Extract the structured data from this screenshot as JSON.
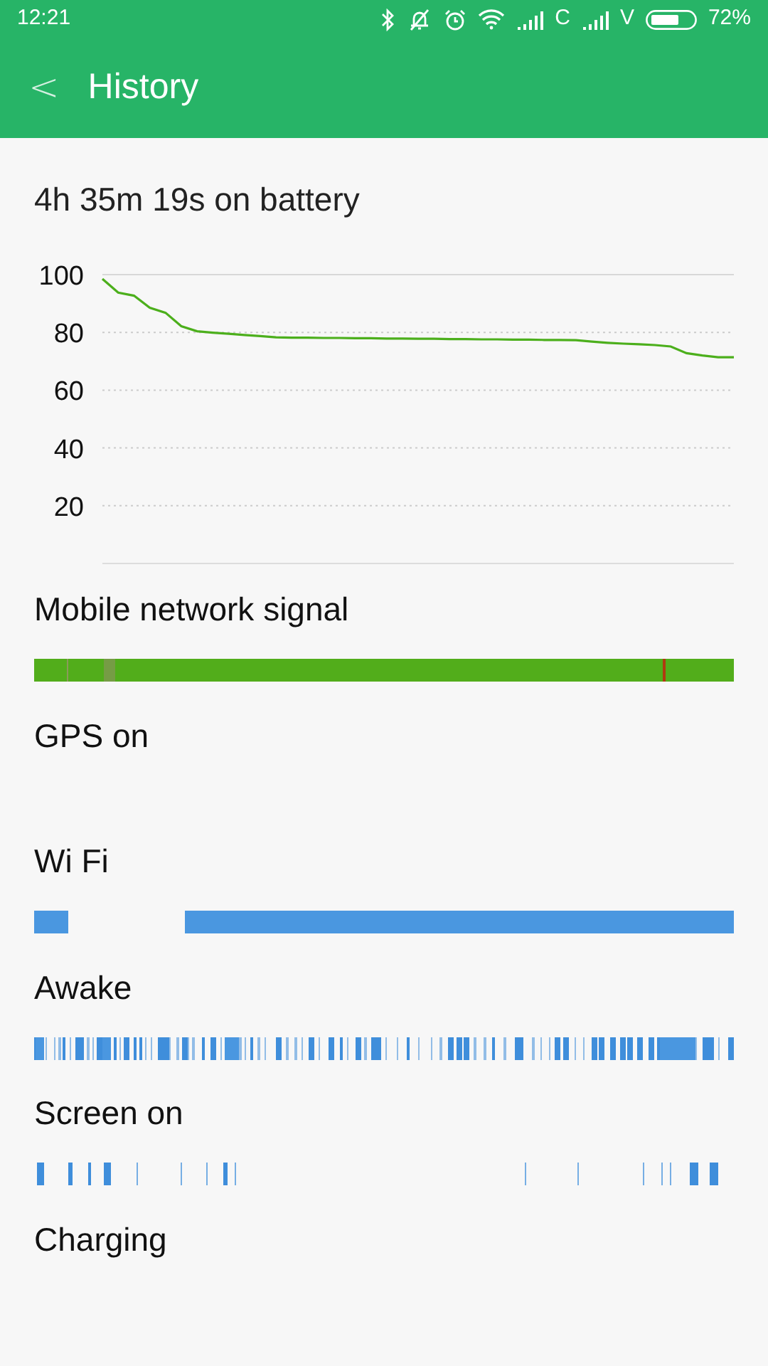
{
  "status_bar": {
    "time": "12:21",
    "network_1": "C",
    "network_2": "V",
    "battery": "72%"
  },
  "app_bar": {
    "back": "<",
    "title": "History"
  },
  "summary": "4h 35m 19s on battery",
  "battery_chart": {
    "chart_data": {
      "type": "line",
      "grid": true,
      "categories": [
        null,
        null,
        null,
        null,
        null,
        null,
        null,
        null,
        null,
        null,
        null,
        null,
        null,
        null,
        null,
        null,
        null,
        null,
        null,
        null,
        null,
        null,
        null,
        null,
        null,
        null,
        null,
        null,
        null,
        null,
        null,
        null,
        null,
        null,
        null,
        null,
        null,
        null,
        null,
        null,
        null
      ],
      "ylim": [
        0,
        100
      ],
      "yticks": [
        {
          "value": 20,
          "label": "20"
        },
        {
          "value": 40,
          "label": "40"
        },
        {
          "value": 60,
          "label": "60"
        },
        {
          "value": 80,
          "label": "80"
        },
        {
          "value": 100,
          "label": "100"
        }
      ],
      "series": [
        {
          "color": "#4caf1c",
          "values": [
            98.5,
            93.8,
            92.7,
            88.5,
            86.8,
            82.1,
            80.4,
            79.9,
            79.5,
            79.1,
            78.7,
            78.3,
            78.2,
            78.2,
            78.1,
            78.1,
            78.0,
            78.0,
            77.9,
            77.9,
            77.8,
            77.8,
            77.7,
            77.7,
            77.6,
            77.6,
            77.5,
            77.5,
            77.4,
            77.4,
            77.3,
            76.8,
            76.4,
            76.1,
            75.9,
            75.6,
            75.1,
            72.8,
            72.0,
            71.4,
            71.4
          ]
        }
      ]
    }
  },
  "rows": [
    {
      "label": "Mobile network signal",
      "kind": "signal"
    },
    {
      "label": "GPS on",
      "kind": "none"
    },
    {
      "label": "Wi Fi",
      "kind": "wifi"
    },
    {
      "label": "Awake",
      "kind": "awake"
    },
    {
      "label": "Screen on",
      "kind": "screen"
    },
    {
      "label": "Charging",
      "kind": "none"
    }
  ]
}
